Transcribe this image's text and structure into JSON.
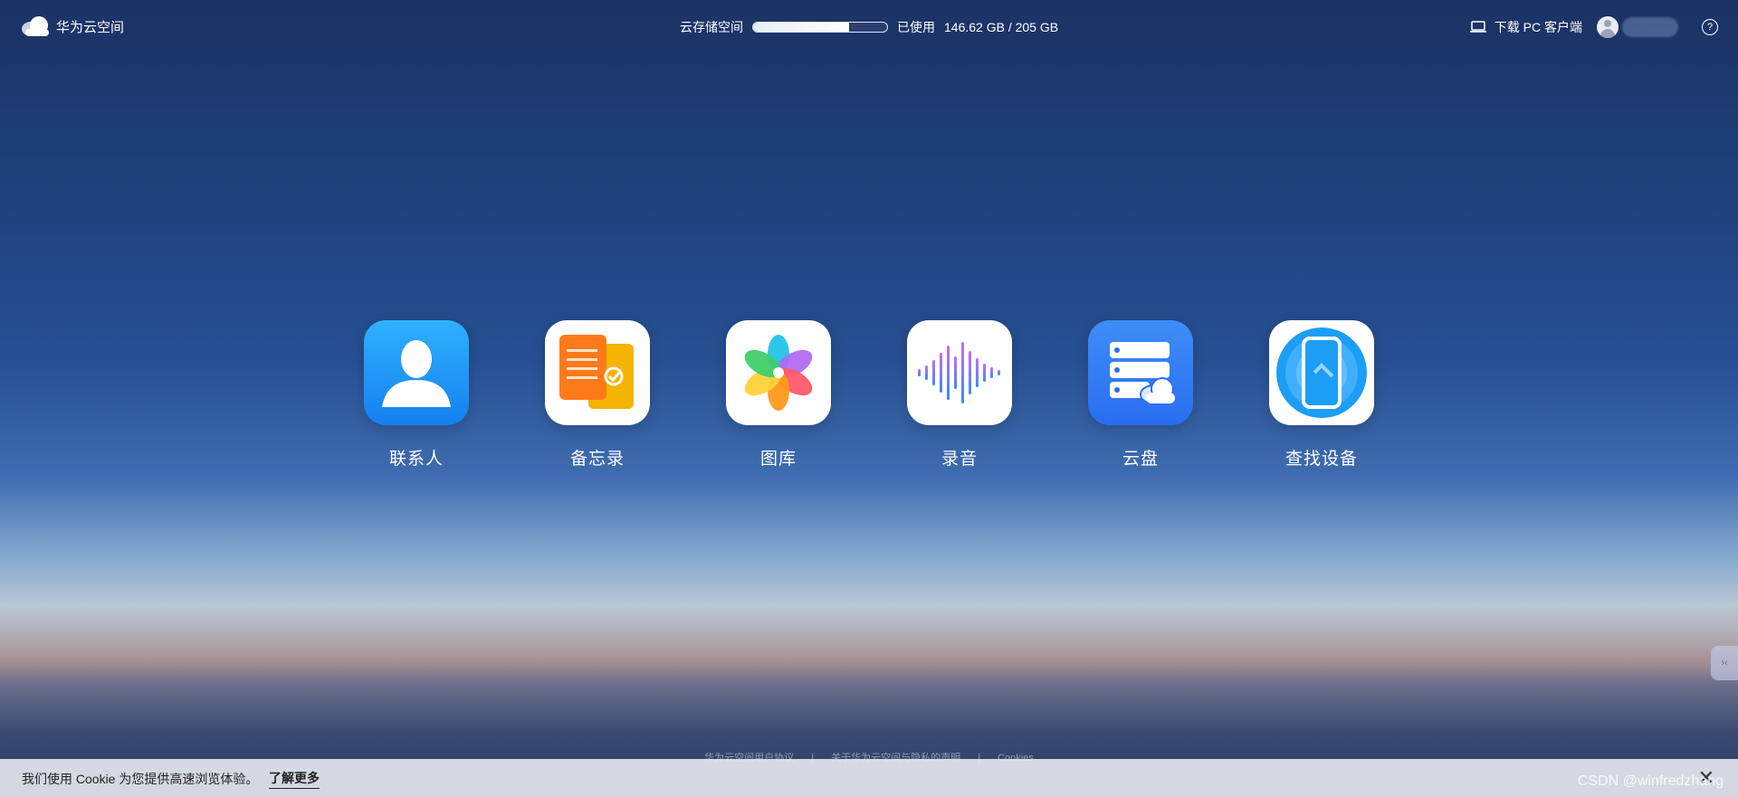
{
  "header": {
    "logo_text": "华为云空间",
    "storage_label": "云存储空间",
    "storage_progress": 0.715,
    "used_label": "已使用",
    "storage_value": "146.62 GB / 205 GB",
    "download_label": "下载 PC 客户端",
    "help_symbol": "?"
  },
  "apps": [
    {
      "label": "联系人",
      "icon": "contacts-icon"
    },
    {
      "label": "备忘录",
      "icon": "notes-icon"
    },
    {
      "label": "图库",
      "icon": "gallery-icon"
    },
    {
      "label": "录音",
      "icon": "recorder-icon"
    },
    {
      "label": "云盘",
      "icon": "cloud-drive-icon"
    },
    {
      "label": "查找设备",
      "icon": "find-device-icon"
    }
  ],
  "footer": {
    "links": [
      "华为云空间用户协议",
      "关于华为云空间与隐私的声明",
      "Cookies"
    ],
    "separator": "|"
  },
  "cookie": {
    "text": "我们使用 Cookie 为您提供高速浏览体验。",
    "more_label": "了解更多",
    "close_symbol": "✕"
  },
  "watermark": "CSDN @winfredzhang",
  "side_tab_symbol": "›‹"
}
